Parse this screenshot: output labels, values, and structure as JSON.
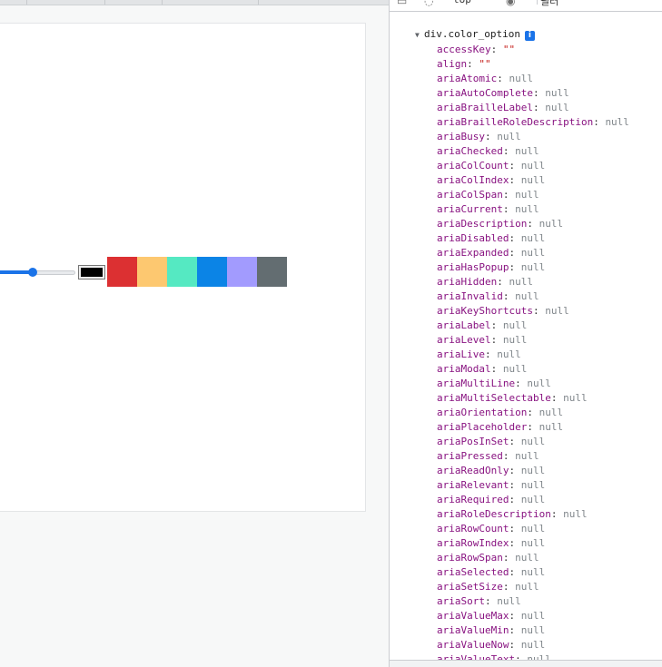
{
  "devtools": {
    "context": "top",
    "filter_placeholder": "필터",
    "object_header": "div.color_option",
    "info_badge": "i",
    "properties": [
      {
        "key": "accessKey",
        "value": "\"\"",
        "kind": "string"
      },
      {
        "key": "align",
        "value": "\"\"",
        "kind": "string"
      },
      {
        "key": "ariaAtomic",
        "value": "null",
        "kind": "null"
      },
      {
        "key": "ariaAutoComplete",
        "value": "null",
        "kind": "null"
      },
      {
        "key": "ariaBrailleLabel",
        "value": "null",
        "kind": "null"
      },
      {
        "key": "ariaBrailleRoleDescription",
        "value": "null",
        "kind": "null"
      },
      {
        "key": "ariaBusy",
        "value": "null",
        "kind": "null"
      },
      {
        "key": "ariaChecked",
        "value": "null",
        "kind": "null"
      },
      {
        "key": "ariaColCount",
        "value": "null",
        "kind": "null"
      },
      {
        "key": "ariaColIndex",
        "value": "null",
        "kind": "null"
      },
      {
        "key": "ariaColSpan",
        "value": "null",
        "kind": "null"
      },
      {
        "key": "ariaCurrent",
        "value": "null",
        "kind": "null"
      },
      {
        "key": "ariaDescription",
        "value": "null",
        "kind": "null"
      },
      {
        "key": "ariaDisabled",
        "value": "null",
        "kind": "null"
      },
      {
        "key": "ariaExpanded",
        "value": "null",
        "kind": "null"
      },
      {
        "key": "ariaHasPopup",
        "value": "null",
        "kind": "null"
      },
      {
        "key": "ariaHidden",
        "value": "null",
        "kind": "null"
      },
      {
        "key": "ariaInvalid",
        "value": "null",
        "kind": "null"
      },
      {
        "key": "ariaKeyShortcuts",
        "value": "null",
        "kind": "null"
      },
      {
        "key": "ariaLabel",
        "value": "null",
        "kind": "null"
      },
      {
        "key": "ariaLevel",
        "value": "null",
        "kind": "null"
      },
      {
        "key": "ariaLive",
        "value": "null",
        "kind": "null"
      },
      {
        "key": "ariaModal",
        "value": "null",
        "kind": "null"
      },
      {
        "key": "ariaMultiLine",
        "value": "null",
        "kind": "null"
      },
      {
        "key": "ariaMultiSelectable",
        "value": "null",
        "kind": "null"
      },
      {
        "key": "ariaOrientation",
        "value": "null",
        "kind": "null"
      },
      {
        "key": "ariaPlaceholder",
        "value": "null",
        "kind": "null"
      },
      {
        "key": "ariaPosInSet",
        "value": "null",
        "kind": "null"
      },
      {
        "key": "ariaPressed",
        "value": "null",
        "kind": "null"
      },
      {
        "key": "ariaReadOnly",
        "value": "null",
        "kind": "null"
      },
      {
        "key": "ariaRelevant",
        "value": "null",
        "kind": "null"
      },
      {
        "key": "ariaRequired",
        "value": "null",
        "kind": "null"
      },
      {
        "key": "ariaRoleDescription",
        "value": "null",
        "kind": "null"
      },
      {
        "key": "ariaRowCount",
        "value": "null",
        "kind": "null"
      },
      {
        "key": "ariaRowIndex",
        "value": "null",
        "kind": "null"
      },
      {
        "key": "ariaRowSpan",
        "value": "null",
        "kind": "null"
      },
      {
        "key": "ariaSelected",
        "value": "null",
        "kind": "null"
      },
      {
        "key": "ariaSetSize",
        "value": "null",
        "kind": "null"
      },
      {
        "key": "ariaSort",
        "value": "null",
        "kind": "null"
      },
      {
        "key": "ariaValueMax",
        "value": "null",
        "kind": "null"
      },
      {
        "key": "ariaValueMin",
        "value": "null",
        "kind": "null"
      },
      {
        "key": "ariaValueNow",
        "value": "null",
        "kind": "null"
      },
      {
        "key": "ariaValueText",
        "value": "null",
        "kind": "null"
      }
    ]
  },
  "toolbar": {
    "slider_value_fraction": 0.43,
    "picker_color": "#000000",
    "color_options": [
      "#dc3032",
      "#fdc870",
      "#55e9c2",
      "#0b84e6",
      "#a29bfe",
      "#636d71"
    ]
  },
  "colors": {
    "accent": "#1a73e8",
    "prop_key": "#881280",
    "string_value": "#c41a16",
    "null_value": "#80868b"
  },
  "icons": [
    "elements-panel-icon",
    "inspect-icon",
    "eye-icon"
  ]
}
